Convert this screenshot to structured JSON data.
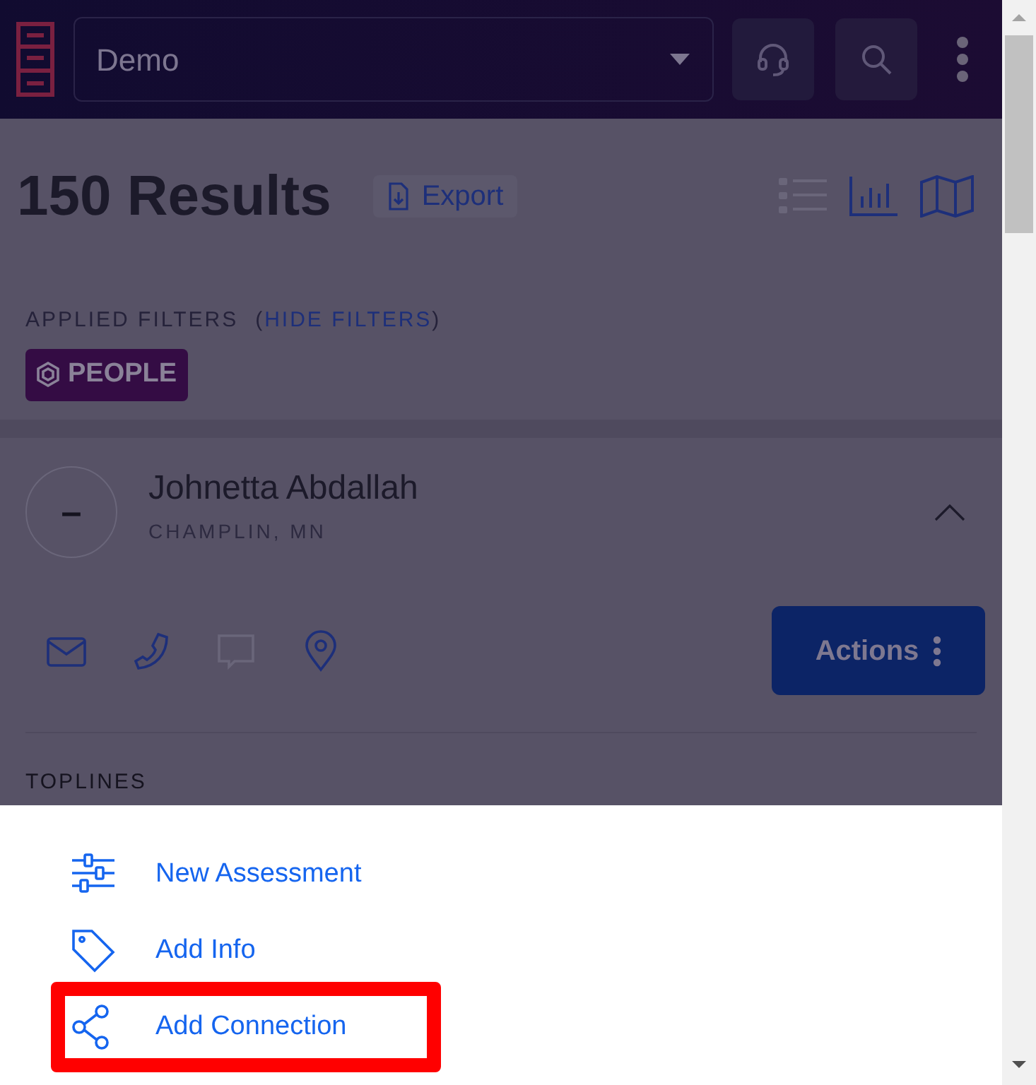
{
  "header": {
    "account_select": {
      "value": "Demo"
    }
  },
  "results": {
    "title": "150 Results",
    "export_label": "Export",
    "views": [
      {
        "kind": "list",
        "selected": false
      },
      {
        "kind": "chart",
        "selected": true
      },
      {
        "kind": "map",
        "selected": true
      }
    ]
  },
  "filters": {
    "label": "APPLIED FILTERS",
    "open_paren": "(",
    "toggle_link": "HIDE FILTERS",
    "close_paren": ")",
    "chips": [
      {
        "label": "PEOPLE"
      }
    ]
  },
  "person": {
    "avatar_text": "–",
    "name": "Johnetta Abdallah",
    "location": "CHAMPLIN, MN",
    "expanded": true,
    "contacts": [
      {
        "kind": "email",
        "disabled": false
      },
      {
        "kind": "phone",
        "disabled": false
      },
      {
        "kind": "message",
        "disabled": true
      },
      {
        "kind": "location",
        "disabled": false
      }
    ],
    "actions_label": "Actions",
    "section_title": "TOPLINES"
  },
  "action_menu": [
    {
      "kind": "assessment",
      "label": "New Assessment",
      "highlighted": false
    },
    {
      "kind": "info",
      "label": "Add Info",
      "highlighted": false
    },
    {
      "kind": "connection",
      "label": "Add Connection",
      "highlighted": true
    }
  ]
}
